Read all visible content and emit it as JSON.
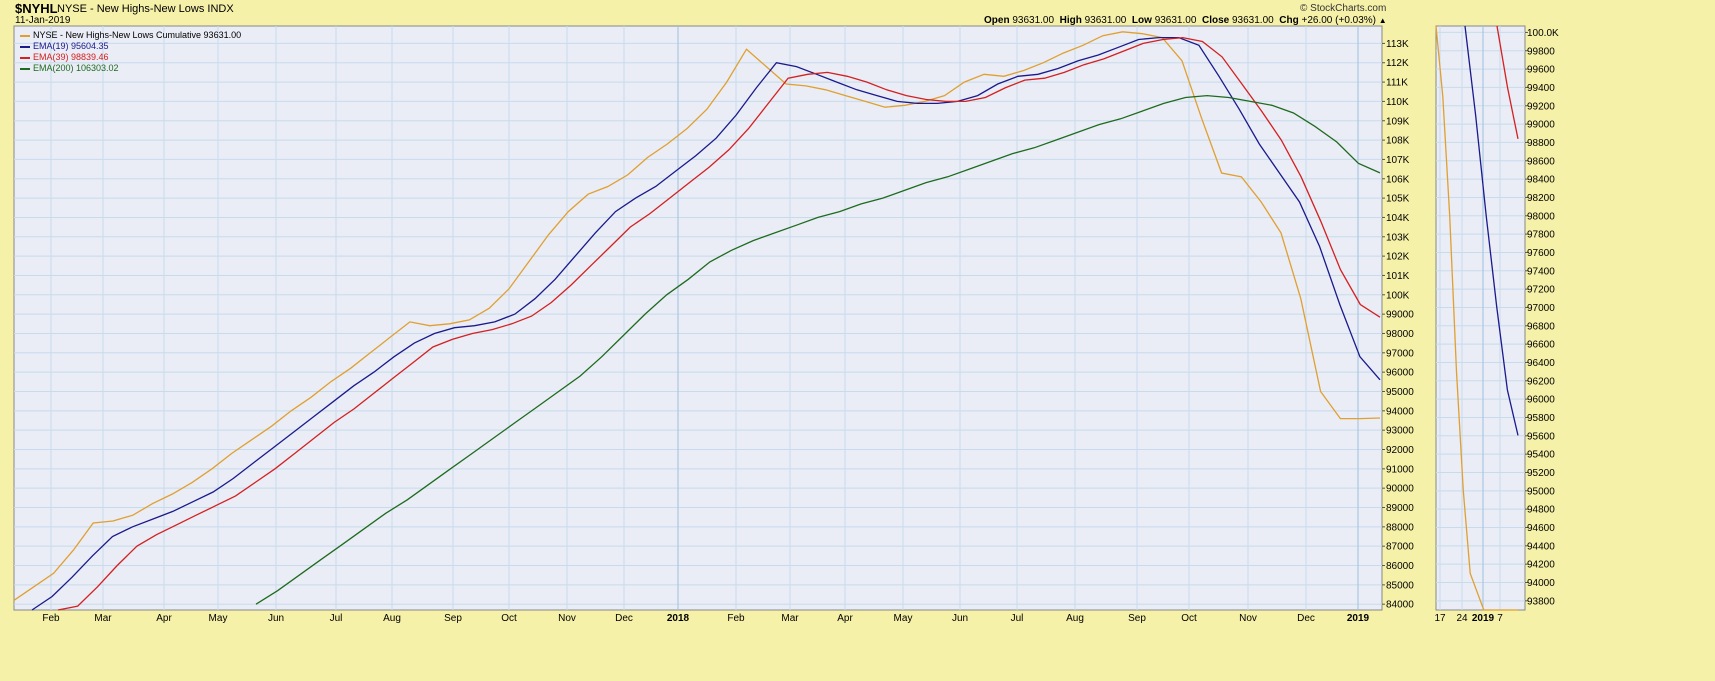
{
  "header": {
    "ticker": "$NYHL",
    "name": "NYSE - New Highs-New Lows",
    "exchange": "INDX",
    "date": "11-Jan-2019",
    "source": "© StockCharts.com",
    "open_label": "Open",
    "open": "93631.00",
    "high_label": "High",
    "high": "93631.00",
    "low_label": "Low",
    "low": "93631.00",
    "close_label": "Close",
    "close": "93631.00",
    "chg_label": "Chg",
    "chg": "+26.00 (+0.03%)"
  },
  "legend": [
    {
      "label": "NYSE - New Highs-New Lows Cumulative 93631.00",
      "color": "#e0a030"
    },
    {
      "label": "EMA(19) 95604.35",
      "color": "#1a1a8c"
    },
    {
      "label": "EMA(39) 98839.46",
      "color": "#d42020"
    },
    {
      "label": "EMA(200) 106303.02",
      "color": "#1e6b1e"
    }
  ],
  "chart_data": [
    {
      "type": "line",
      "xlabel": "",
      "ylabel": "",
      "x_tick_labels": [
        "Feb",
        "Mar",
        "Apr",
        "May",
        "Jun",
        "Jul",
        "Aug",
        "Sep",
        "Oct",
        "Nov",
        "Dec",
        "2018",
        "Feb",
        "Mar",
        "Apr",
        "May",
        "Jun",
        "Jul",
        "Aug",
        "Sep",
        "Oct",
        "Nov",
        "Dec",
        "2019"
      ],
      "y_tick_labels": [
        "84000",
        "85000",
        "86000",
        "87000",
        "88000",
        "89000",
        "90000",
        "91000",
        "92000",
        "93000",
        "94000",
        "95000",
        "96000",
        "97000",
        "98000",
        "99000",
        "100K",
        "101K",
        "102K",
        "103K",
        "104K",
        "105K",
        "106K",
        "107K",
        "108K",
        "109K",
        "110K",
        "111K",
        "112K",
        "113K"
      ],
      "ylim": [
        83700,
        113900
      ],
      "series": [
        {
          "name": "NYSE - New Highs-New Lows Cumulative",
          "color": "#e0a030",
          "values": [
            84200,
            84900,
            85600,
            86800,
            88200,
            88300,
            88600,
            89200,
            89700,
            90300,
            91000,
            91800,
            92500,
            93200,
            94000,
            94700,
            95500,
            96200,
            97000,
            97800,
            98600,
            98400,
            98500,
            98700,
            99300,
            100300,
            101700,
            103100,
            104300,
            105200,
            105600,
            106200,
            107100,
            107800,
            108600,
            109600,
            111000,
            112700,
            111800,
            110900,
            110800,
            110600,
            110300,
            110000,
            109700,
            109800,
            110000,
            110300,
            111000,
            111400,
            111300,
            111600,
            112000,
            112500,
            112900,
            113400,
            113600,
            113500,
            113300,
            112100,
            109100,
            106300,
            106100,
            104800,
            103200,
            99800,
            95000,
            93600,
            93600,
            93631
          ]
        },
        {
          "name": "EMA(19)",
          "color": "#1a1a8c",
          "values": [
            83700,
            84400,
            85400,
            86500,
            87500,
            88000,
            88400,
            88800,
            89300,
            89800,
            90500,
            91300,
            92100,
            92900,
            93700,
            94500,
            95300,
            96000,
            96800,
            97500,
            98000,
            98300,
            98400,
            98600,
            99000,
            99800,
            100800,
            102000,
            103200,
            104300,
            105000,
            105600,
            106400,
            107200,
            108100,
            109300,
            110700,
            112000,
            111800,
            111400,
            111000,
            110600,
            110300,
            110000,
            109900,
            109900,
            110000,
            110300,
            110900,
            111300,
            111400,
            111700,
            112100,
            112400,
            112800,
            113200,
            113300,
            113300,
            112900,
            111300,
            109600,
            107800,
            106300,
            104800,
            102500,
            99500,
            96800,
            95604
          ]
        },
        {
          "name": "EMA(39)",
          "color": "#d42020",
          "values": [
            83100,
            83900,
            84900,
            86000,
            87000,
            87600,
            88100,
            88600,
            89100,
            89600,
            90300,
            91000,
            91800,
            92600,
            93400,
            94100,
            94900,
            95700,
            96500,
            97300,
            97700,
            98000,
            98200,
            98500,
            98900,
            99600,
            100500,
            101500,
            102500,
            103500,
            104200,
            105000,
            105800,
            106600,
            107500,
            108600,
            109900,
            111200,
            111400,
            111500,
            111300,
            111000,
            110600,
            110300,
            110100,
            110000,
            110000,
            110200,
            110700,
            111100,
            111200,
            111500,
            111900,
            112200,
            112600,
            113000,
            113200,
            113300,
            113100,
            112300,
            110900,
            109500,
            108000,
            106100,
            103800,
            101300,
            99500,
            98839
          ]
        },
        {
          "name": "EMA(200)",
          "color": "#1e6b1e",
          "values": [
            84000,
            84700,
            85500,
            86300,
            87100,
            87900,
            88700,
            89400,
            90200,
            91000,
            91800,
            92600,
            93400,
            94200,
            95000,
            95800,
            96800,
            97900,
            99000,
            100000,
            100800,
            101700,
            102300,
            102800,
            103200,
            103600,
            104000,
            104300,
            104700,
            105000,
            105400,
            105800,
            106100,
            106500,
            106900,
            107300,
            107600,
            108000,
            108400,
            108800,
            109100,
            109500,
            109900,
            110200,
            110300,
            110200,
            110000,
            109800,
            109400,
            108700,
            107900,
            106800,
            106303
          ]
        }
      ]
    },
    {
      "type": "line",
      "x_tick_labels": [
        "17",
        "24",
        "2019",
        "7"
      ],
      "y_tick_labels": [
        "93800",
        "94000",
        "94200",
        "94400",
        "94600",
        "94800",
        "95000",
        "95200",
        "95400",
        "95600",
        "95800",
        "96000",
        "96200",
        "96400",
        "96600",
        "96800",
        "97000",
        "97200",
        "97400",
        "97600",
        "97800",
        "98000",
        "98200",
        "98400",
        "98600",
        "98800",
        "99000",
        "99200",
        "99400",
        "99600",
        "99800",
        "100.0K"
      ],
      "ylim": [
        93700,
        100070
      ],
      "series": [
        {
          "name": "Cumulative",
          "color": "#e0a030",
          "values": [
            100070,
            99300,
            98000,
            96300,
            95000,
            94100,
            93900,
            93700,
            93640,
            93631,
            93631,
            93631,
            93650
          ]
        },
        {
          "name": "EMA(19)",
          "color": "#1a1a8c",
          "values": [
            100070,
            99100,
            98000,
            97000,
            96100,
            95604
          ]
        },
        {
          "name": "EMA(39)",
          "color": "#d42020",
          "values": [
            100070,
            99400,
            98839
          ]
        }
      ]
    }
  ]
}
